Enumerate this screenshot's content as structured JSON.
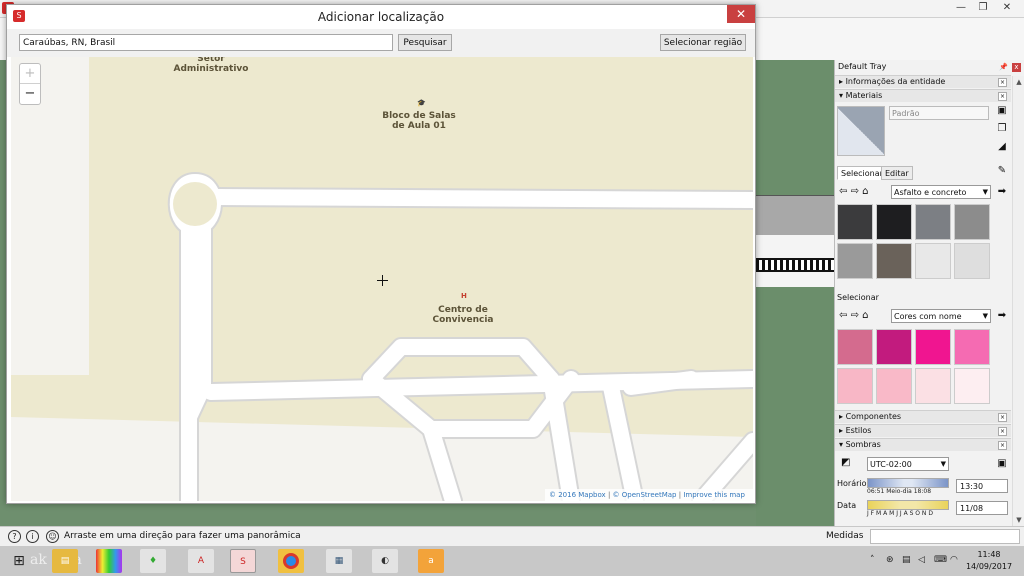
{
  "dialog": {
    "title": "Adicionar localização",
    "close_glyph": "✕",
    "search_value": "Caraúbas, RN, Brasil",
    "search_button": "Pesquisar",
    "select_region_button": "Selecionar região"
  },
  "map": {
    "zoom_in": "+",
    "zoom_out": "−",
    "labels": {
      "setor": "Setor\nAdministrativo",
      "bloco": "Bloco de Salas\nde Aula 01",
      "centro": "Centro de\nConvivencia"
    },
    "attribution": {
      "mapbox": "© 2016 Mapbox",
      "osm": "© OpenStreetMap",
      "improve": "Improve this map"
    },
    "colors": {
      "land": "#ede9cf",
      "road": "#ffffff",
      "road_edge": "#d6d6d6",
      "background": "#f4f3ef"
    }
  },
  "tray": {
    "title": "Default Tray",
    "sections": {
      "entity_info": "Informações da entidade",
      "materials": "Materiais",
      "components": "Componentes",
      "styles": "Estilos",
      "shadows": "Sombras"
    },
    "material_name_placeholder": "Padrão",
    "tabs": {
      "select": "Selecionar",
      "edit": "Editar"
    },
    "library_1": "Asfalto e concreto",
    "select_label_2": "Selecionar",
    "library_2": "Cores com nome",
    "swatches_1": [
      "#3b3b3d",
      "#1e1e20",
      "#7c7f84",
      "#8c8c8c",
      "#9a9a9a",
      "#6a625a",
      "#e8e8e8",
      "#dedede"
    ],
    "swatches_2": [
      "#d46b8e",
      "#c21b7e",
      "#f01590",
      "#f56bb2",
      "#f8b7c6",
      "#f9b9c8",
      "#fbe0e4",
      "#fdeef1"
    ],
    "shadows": {
      "timezone": "UTC-02:00",
      "time_label": "Horário",
      "time_ticks": "06:51   Meio-dia   18:08",
      "time_value": "13:30",
      "date_label": "Data",
      "date_ticks": "J F M A M J J A S O N D",
      "date_value": "11/08"
    }
  },
  "statusbar": {
    "message": "Arraste em uma direção para fazer uma panorâmica",
    "measure_label": "Medidas"
  },
  "taskbar": {
    "time": "11:48",
    "date": "14/09/2017",
    "watermark": "ak   ma"
  }
}
